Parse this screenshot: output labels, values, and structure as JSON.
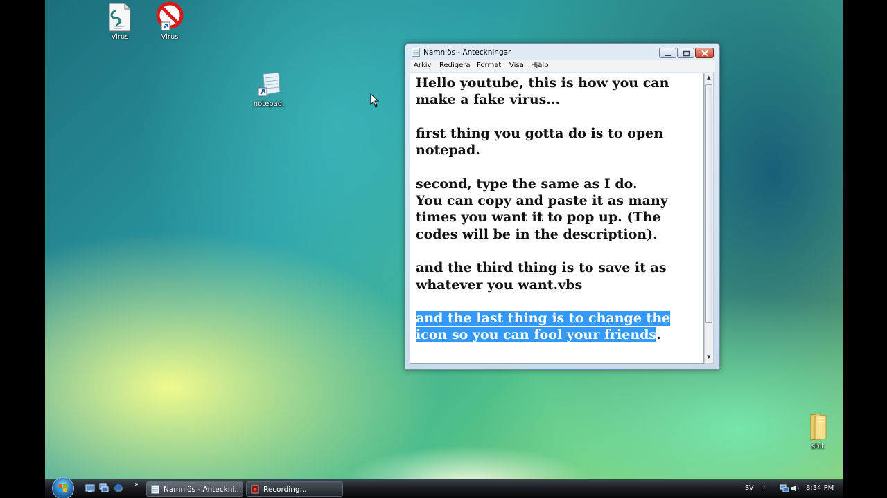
{
  "desktop": {
    "icons": [
      {
        "label": "Virus",
        "icon": "script-file-icon"
      },
      {
        "label": "Virus",
        "icon": "no-sign-shortcut-icon"
      },
      {
        "label": "notepad.",
        "icon": "notepad-shortcut-icon"
      },
      {
        "label": "shit",
        "icon": "folder-icon"
      }
    ]
  },
  "window": {
    "title": "Namnlös - Anteckningar",
    "menu": [
      "Arkiv",
      "Redigera",
      "Format",
      "Visa",
      "Hjälp"
    ],
    "text": {
      "plain_lines": [
        "Hello youtube, this is how you can",
        "make a fake virus...",
        "",
        "first thing you gotta do is to open",
        "notepad.",
        "",
        "second, type the same as I do.",
        "You can copy and paste it as many",
        "times you want it to pop up. (The",
        "codes will be in the description).",
        "",
        "and the third thing is to save it as",
        "whatever you want.vbs",
        ""
      ],
      "selected_line1": "and the last thing is to change the",
      "selected_line2": "icon so you can fool your friends",
      "trailing": "."
    }
  },
  "taskbar": {
    "buttons": [
      {
        "label": "Namnlös - Anteckni...",
        "icon": "notepad-icon"
      },
      {
        "label": "Recording...",
        "icon": "recording-icon"
      }
    ],
    "tray": {
      "language": "SV",
      "time": "8:34 PM"
    }
  },
  "colors": {
    "selection": "#3399ff",
    "close_button": "#c84a2f"
  }
}
